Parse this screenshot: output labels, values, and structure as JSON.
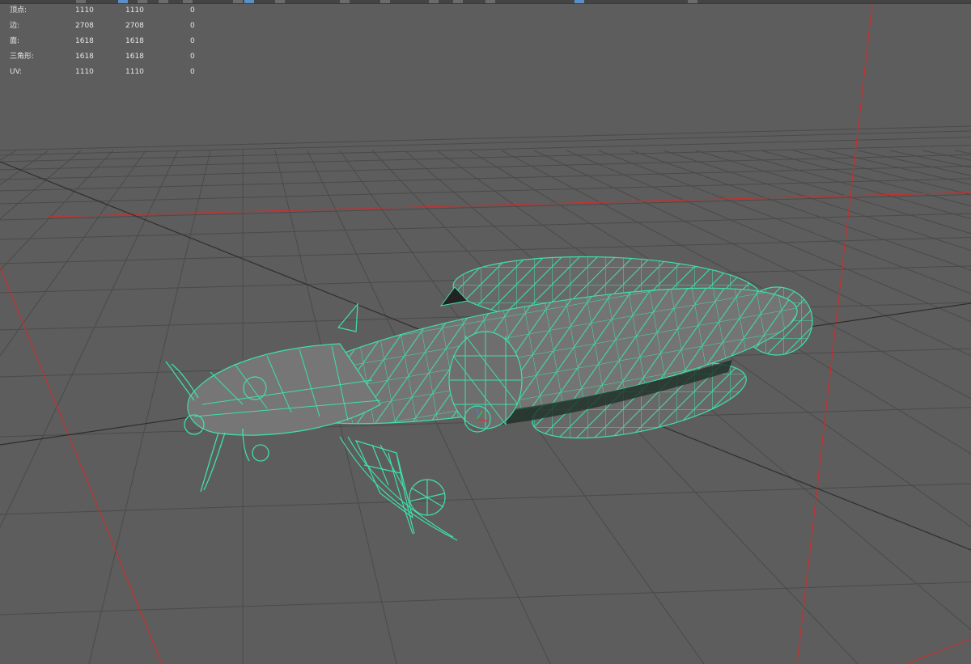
{
  "stats": {
    "rows": [
      {
        "label": "顶点:",
        "a": "1110",
        "b": "1110",
        "c": "0"
      },
      {
        "label": "边:",
        "a": "2708",
        "b": "2708",
        "c": "0"
      },
      {
        "label": "面:",
        "a": "1618",
        "b": "1618",
        "c": "0"
      },
      {
        "label": "三角形:",
        "a": "1618",
        "b": "1618",
        "c": "0"
      },
      {
        "label": "UV:",
        "a": "1110",
        "b": "1110",
        "c": "0"
      }
    ]
  },
  "colors": {
    "background": "#5d5d5d",
    "grid": "#4a4a4a",
    "grid_axis": "#2e2e2e",
    "axis_red": "#c43030",
    "wireframe": "#3fe0a8",
    "mesh_fill": "#6c6c6c"
  },
  "scene": {
    "object": "catfish-wireframe-model",
    "selected": true
  }
}
